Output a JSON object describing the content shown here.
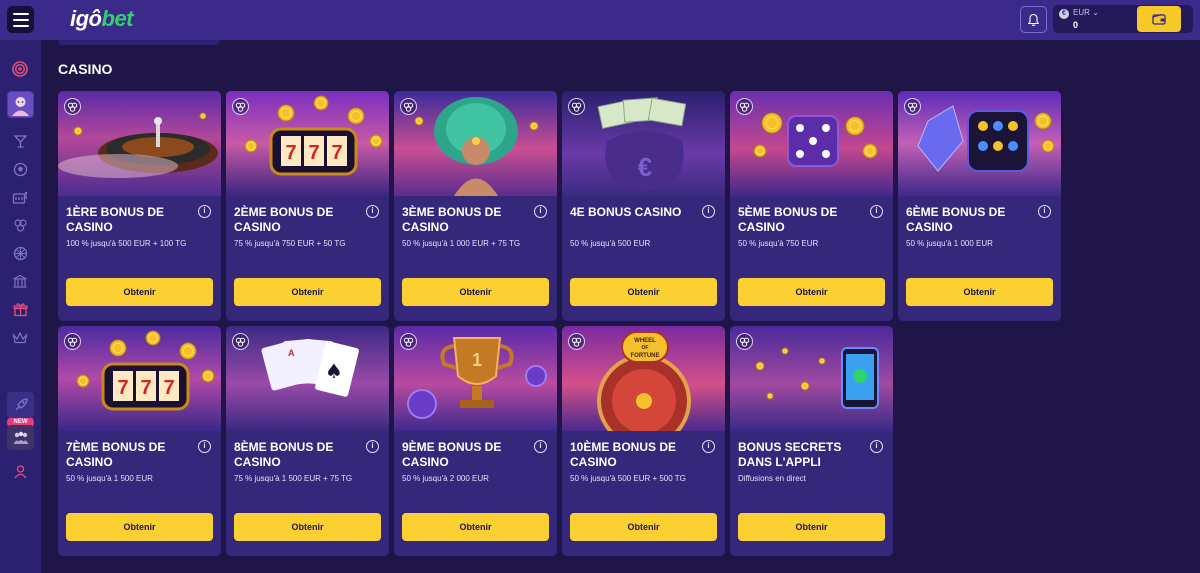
{
  "header": {
    "logo_left": "igô",
    "logo_right": "bet",
    "currency": "EUR",
    "balance": "0",
    "accent": "#f7c928"
  },
  "sidebar": {
    "new_badge": "NEW",
    "icons": [
      "target-icon",
      "avatar-icon",
      "cocktail-icon",
      "soccer-ball-icon",
      "slot-machine-icon",
      "bonus-circles-icon",
      "wheel-icon",
      "bank-icon",
      "gift-icon",
      "crown-icon",
      "rocket-icon",
      "crowd-icon",
      "user-icon"
    ]
  },
  "main": {
    "section_title": "CASINO",
    "cards": [
      {
        "title": "1ÈRE BONUS DE CASINO",
        "desc": "100 % jusqu'à 500 EUR + 100 TG",
        "button": "Obtenir",
        "art": "roulette"
      },
      {
        "title": "2ÈME BONUS DE CASINO",
        "desc": "75 % jusqu'à 750 EUR + 50 TG",
        "button": "Obtenir",
        "art": "slot777"
      },
      {
        "title": "3ÈME BONUS DE CASINO",
        "desc": "50 % jusqu'à 1 000 EUR + 75 TG",
        "button": "Obtenir",
        "art": "carnival"
      },
      {
        "title": "4E BONUS CASINO",
        "desc": "50 % jusqu'à 500 EUR",
        "button": "Obtenir",
        "art": "moneybag"
      },
      {
        "title": "5ÈME BONUS DE CASINO",
        "desc": "50 % jusqu'à 750 EUR",
        "button": "Obtenir",
        "art": "dice"
      },
      {
        "title": "6ÈME BONUS DE CASINO",
        "desc": "50 % jusqu'à 1 000 EUR",
        "button": "Obtenir",
        "art": "diamond"
      },
      {
        "title": "7ÈME BONUS DE CASINO",
        "desc": "50 % jusqu'à 1 500 EUR",
        "button": "Obtenir",
        "art": "slot777b"
      },
      {
        "title": "8ÈME BONUS DE CASINO",
        "desc": "75 % jusqu'à 1 500 EUR + 75 TG",
        "button": "Obtenir",
        "art": "cards"
      },
      {
        "title": "9ÈME BONUS DE CASINO",
        "desc": "50 % jusqu'à 2 000 EUR",
        "button": "Obtenir",
        "art": "trophy"
      },
      {
        "title": "10ÈME BONUS DE CASINO",
        "desc": "50 % jusqu'à 500 EUR + 500 TG",
        "button": "Obtenir",
        "art": "wheel"
      },
      {
        "title": "BONUS SECRETS DANS L'APPLI",
        "desc": "Diffusions en direct",
        "button": "Obtenir",
        "art": "phone"
      }
    ],
    "art_text": {
      "slot_number": "777",
      "wheel_line1": "WHEEL",
      "wheel_line2": "OF",
      "wheel_line3": "FORTUNE",
      "trophy_number": "1",
      "euro_sign": "€",
      "card_rank": "A"
    }
  }
}
